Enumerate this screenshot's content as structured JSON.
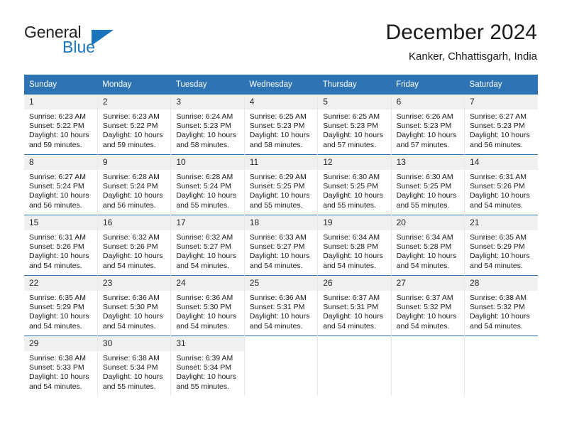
{
  "brand": {
    "name_top": "General",
    "name_bottom": "Blue",
    "color_primary": "#1b75bb",
    "color_text": "#231f20"
  },
  "header": {
    "title": "December 2024",
    "subtitle": "Kanker, Chhattisgarh, India"
  },
  "theme": {
    "header_bg": "#2e74b5",
    "header_text": "#ffffff",
    "daynum_bg": "#f0f0f0",
    "row_divider": "#2e74b5"
  },
  "weekdays": [
    "Sunday",
    "Monday",
    "Tuesday",
    "Wednesday",
    "Thursday",
    "Friday",
    "Saturday"
  ],
  "labels": {
    "sunrise_prefix": "Sunrise:",
    "sunset_prefix": "Sunset:",
    "daylight_prefix": "Daylight:"
  },
  "weeks": [
    [
      {
        "day": "1",
        "sunrise": "Sunrise: 6:23 AM",
        "sunset": "Sunset: 5:22 PM",
        "daylight": "Daylight: 10 hours and 59 minutes."
      },
      {
        "day": "2",
        "sunrise": "Sunrise: 6:23 AM",
        "sunset": "Sunset: 5:22 PM",
        "daylight": "Daylight: 10 hours and 59 minutes."
      },
      {
        "day": "3",
        "sunrise": "Sunrise: 6:24 AM",
        "sunset": "Sunset: 5:23 PM",
        "daylight": "Daylight: 10 hours and 58 minutes."
      },
      {
        "day": "4",
        "sunrise": "Sunrise: 6:25 AM",
        "sunset": "Sunset: 5:23 PM",
        "daylight": "Daylight: 10 hours and 58 minutes."
      },
      {
        "day": "5",
        "sunrise": "Sunrise: 6:25 AM",
        "sunset": "Sunset: 5:23 PM",
        "daylight": "Daylight: 10 hours and 57 minutes."
      },
      {
        "day": "6",
        "sunrise": "Sunrise: 6:26 AM",
        "sunset": "Sunset: 5:23 PM",
        "daylight": "Daylight: 10 hours and 57 minutes."
      },
      {
        "day": "7",
        "sunrise": "Sunrise: 6:27 AM",
        "sunset": "Sunset: 5:23 PM",
        "daylight": "Daylight: 10 hours and 56 minutes."
      }
    ],
    [
      {
        "day": "8",
        "sunrise": "Sunrise: 6:27 AM",
        "sunset": "Sunset: 5:24 PM",
        "daylight": "Daylight: 10 hours and 56 minutes."
      },
      {
        "day": "9",
        "sunrise": "Sunrise: 6:28 AM",
        "sunset": "Sunset: 5:24 PM",
        "daylight": "Daylight: 10 hours and 56 minutes."
      },
      {
        "day": "10",
        "sunrise": "Sunrise: 6:28 AM",
        "sunset": "Sunset: 5:24 PM",
        "daylight": "Daylight: 10 hours and 55 minutes."
      },
      {
        "day": "11",
        "sunrise": "Sunrise: 6:29 AM",
        "sunset": "Sunset: 5:25 PM",
        "daylight": "Daylight: 10 hours and 55 minutes."
      },
      {
        "day": "12",
        "sunrise": "Sunrise: 6:30 AM",
        "sunset": "Sunset: 5:25 PM",
        "daylight": "Daylight: 10 hours and 55 minutes."
      },
      {
        "day": "13",
        "sunrise": "Sunrise: 6:30 AM",
        "sunset": "Sunset: 5:25 PM",
        "daylight": "Daylight: 10 hours and 55 minutes."
      },
      {
        "day": "14",
        "sunrise": "Sunrise: 6:31 AM",
        "sunset": "Sunset: 5:26 PM",
        "daylight": "Daylight: 10 hours and 54 minutes."
      }
    ],
    [
      {
        "day": "15",
        "sunrise": "Sunrise: 6:31 AM",
        "sunset": "Sunset: 5:26 PM",
        "daylight": "Daylight: 10 hours and 54 minutes."
      },
      {
        "day": "16",
        "sunrise": "Sunrise: 6:32 AM",
        "sunset": "Sunset: 5:26 PM",
        "daylight": "Daylight: 10 hours and 54 minutes."
      },
      {
        "day": "17",
        "sunrise": "Sunrise: 6:32 AM",
        "sunset": "Sunset: 5:27 PM",
        "daylight": "Daylight: 10 hours and 54 minutes."
      },
      {
        "day": "18",
        "sunrise": "Sunrise: 6:33 AM",
        "sunset": "Sunset: 5:27 PM",
        "daylight": "Daylight: 10 hours and 54 minutes."
      },
      {
        "day": "19",
        "sunrise": "Sunrise: 6:34 AM",
        "sunset": "Sunset: 5:28 PM",
        "daylight": "Daylight: 10 hours and 54 minutes."
      },
      {
        "day": "20",
        "sunrise": "Sunrise: 6:34 AM",
        "sunset": "Sunset: 5:28 PM",
        "daylight": "Daylight: 10 hours and 54 minutes."
      },
      {
        "day": "21",
        "sunrise": "Sunrise: 6:35 AM",
        "sunset": "Sunset: 5:29 PM",
        "daylight": "Daylight: 10 hours and 54 minutes."
      }
    ],
    [
      {
        "day": "22",
        "sunrise": "Sunrise: 6:35 AM",
        "sunset": "Sunset: 5:29 PM",
        "daylight": "Daylight: 10 hours and 54 minutes."
      },
      {
        "day": "23",
        "sunrise": "Sunrise: 6:36 AM",
        "sunset": "Sunset: 5:30 PM",
        "daylight": "Daylight: 10 hours and 54 minutes."
      },
      {
        "day": "24",
        "sunrise": "Sunrise: 6:36 AM",
        "sunset": "Sunset: 5:30 PM",
        "daylight": "Daylight: 10 hours and 54 minutes."
      },
      {
        "day": "25",
        "sunrise": "Sunrise: 6:36 AM",
        "sunset": "Sunset: 5:31 PM",
        "daylight": "Daylight: 10 hours and 54 minutes."
      },
      {
        "day": "26",
        "sunrise": "Sunrise: 6:37 AM",
        "sunset": "Sunset: 5:31 PM",
        "daylight": "Daylight: 10 hours and 54 minutes."
      },
      {
        "day": "27",
        "sunrise": "Sunrise: 6:37 AM",
        "sunset": "Sunset: 5:32 PM",
        "daylight": "Daylight: 10 hours and 54 minutes."
      },
      {
        "day": "28",
        "sunrise": "Sunrise: 6:38 AM",
        "sunset": "Sunset: 5:32 PM",
        "daylight": "Daylight: 10 hours and 54 minutes."
      }
    ],
    [
      {
        "day": "29",
        "sunrise": "Sunrise: 6:38 AM",
        "sunset": "Sunset: 5:33 PM",
        "daylight": "Daylight: 10 hours and 54 minutes."
      },
      {
        "day": "30",
        "sunrise": "Sunrise: 6:38 AM",
        "sunset": "Sunset: 5:34 PM",
        "daylight": "Daylight: 10 hours and 55 minutes."
      },
      {
        "day": "31",
        "sunrise": "Sunrise: 6:39 AM",
        "sunset": "Sunset: 5:34 PM",
        "daylight": "Daylight: 10 hours and 55 minutes."
      },
      {
        "day": "",
        "sunrise": "",
        "sunset": "",
        "daylight": ""
      },
      {
        "day": "",
        "sunrise": "",
        "sunset": "",
        "daylight": ""
      },
      {
        "day": "",
        "sunrise": "",
        "sunset": "",
        "daylight": ""
      },
      {
        "day": "",
        "sunrise": "",
        "sunset": "",
        "daylight": ""
      }
    ]
  ]
}
